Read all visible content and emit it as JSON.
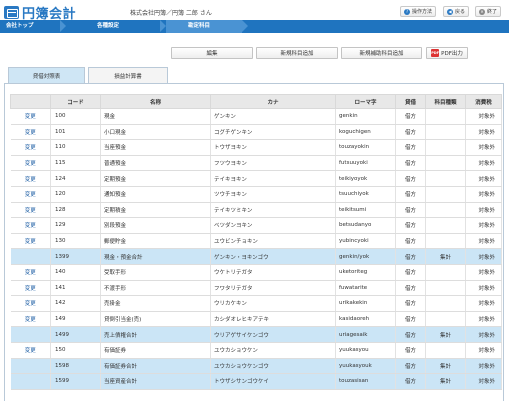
{
  "header": {
    "logo_text": "円簿会計",
    "company": "株式会社円簿／円簿 二郎 さん",
    "buttons": [
      {
        "label": "操作方法",
        "icon": "help-icon",
        "icon_char": "?",
        "color": "#2a79c3"
      },
      {
        "label": "戻る",
        "icon": "back-arrow-icon",
        "icon_char": "◀",
        "color": "#2a79c3"
      },
      {
        "label": "終了",
        "icon": "close-icon",
        "icon_char": "✕",
        "color": "#888888"
      }
    ]
  },
  "nav": {
    "items": [
      "会社トップ",
      "各種設定",
      "勘定科目"
    ]
  },
  "actions": {
    "edit": "編集",
    "add_account": "新規科目追加",
    "add_sub_account": "新規補助科目追加",
    "pdf": "PDF出力",
    "pdf_icon": "PDF"
  },
  "tabs": [
    "貸借対照表",
    "損益計算書"
  ],
  "table": {
    "headers": [
      "",
      "コード",
      "名称",
      "カナ",
      "ローマ字",
      "貸借",
      "科目種類",
      "消費税"
    ],
    "rows": [
      {
        "edit": "変更",
        "code": "100",
        "name": "現金",
        "kana": "ゲンキン",
        "romaji": "genkin",
        "side": "借方",
        "kind": "",
        "tax": "対象外",
        "total": false
      },
      {
        "edit": "変更",
        "code": "101",
        "name": "小口現金",
        "kana": "コグチゲンキン",
        "romaji": "koguchigen",
        "side": "借方",
        "kind": "",
        "tax": "対象外",
        "total": false
      },
      {
        "edit": "変更",
        "code": "110",
        "name": "当座預金",
        "kana": "トウザヨキン",
        "romaji": "touzayokin",
        "side": "借方",
        "kind": "",
        "tax": "対象外",
        "total": false
      },
      {
        "edit": "変更",
        "code": "115",
        "name": "普通預金",
        "kana": "フツウヨキン",
        "romaji": "futsuuyoki",
        "side": "借方",
        "kind": "",
        "tax": "対象外",
        "total": false
      },
      {
        "edit": "変更",
        "code": "124",
        "name": "定期預金",
        "kana": "テイキヨキン",
        "romaji": "teikiyoyok",
        "side": "借方",
        "kind": "",
        "tax": "対象外",
        "total": false
      },
      {
        "edit": "変更",
        "code": "120",
        "name": "通知預金",
        "kana": "ツウチヨキン",
        "romaji": "tsuuchiyok",
        "side": "借方",
        "kind": "",
        "tax": "対象外",
        "total": false
      },
      {
        "edit": "変更",
        "code": "128",
        "name": "定期積金",
        "kana": "テイキツミキン",
        "romaji": "teikitsumi",
        "side": "借方",
        "kind": "",
        "tax": "対象外",
        "total": false
      },
      {
        "edit": "変更",
        "code": "129",
        "name": "別段預金",
        "kana": "ベツダンヨキン",
        "romaji": "betsudanyo",
        "side": "借方",
        "kind": "",
        "tax": "対象外",
        "total": false
      },
      {
        "edit": "変更",
        "code": "130",
        "name": "郵便貯金",
        "kana": "ユウビンチョキン",
        "romaji": "yubincyoki",
        "side": "借方",
        "kind": "",
        "tax": "対象外",
        "total": false
      },
      {
        "edit": "",
        "code": "1399",
        "name": "現金・預金合計",
        "kana": "ゲンキン・ヨキンゴウ",
        "romaji": "genkin/yok",
        "side": "借方",
        "kind": "集計",
        "tax": "対象外",
        "total": true
      },
      {
        "edit": "変更",
        "code": "140",
        "name": "受取手形",
        "kana": "ウケトリテガタ",
        "romaji": "uketoriteg",
        "side": "借方",
        "kind": "",
        "tax": "対象外",
        "total": false
      },
      {
        "edit": "変更",
        "code": "141",
        "name": "不渡手形",
        "kana": "フワタリテガタ",
        "romaji": "fuwatarite",
        "side": "借方",
        "kind": "",
        "tax": "対象外",
        "total": false
      },
      {
        "edit": "変更",
        "code": "142",
        "name": "売掛金",
        "kana": "ウリカケキン",
        "romaji": "urikakekin",
        "side": "借方",
        "kind": "",
        "tax": "対象外",
        "total": false
      },
      {
        "edit": "変更",
        "code": "149",
        "name": "貸倒引当金(売)",
        "kana": "カシダオレヒキアテキ",
        "romaji": "kasidaoreh",
        "side": "借方",
        "kind": "",
        "tax": "対象外",
        "total": false
      },
      {
        "edit": "",
        "code": "1499",
        "name": "売上債権合計",
        "kana": "ウリアゲサイケンゴウ",
        "romaji": "uriagesaik",
        "side": "借方",
        "kind": "集計",
        "tax": "対象外",
        "total": true
      },
      {
        "edit": "変更",
        "code": "150",
        "name": "有価証券",
        "kana": "ユウカショウケン",
        "romaji": "yuukasyou",
        "side": "借方",
        "kind": "",
        "tax": "対象外",
        "total": false
      },
      {
        "edit": "",
        "code": "1598",
        "name": "有価証券合計",
        "kana": "ユウカショウケンゴウ",
        "romaji": "yuukasyouk",
        "side": "借方",
        "kind": "集計",
        "tax": "対象外",
        "total": true
      },
      {
        "edit": "",
        "code": "1599",
        "name": "当座資産合計",
        "kana": "トウザシサンゴウケイ",
        "romaji": "touzasisan",
        "side": "借方",
        "kind": "集計",
        "tax": "対象外",
        "total": true
      }
    ]
  }
}
